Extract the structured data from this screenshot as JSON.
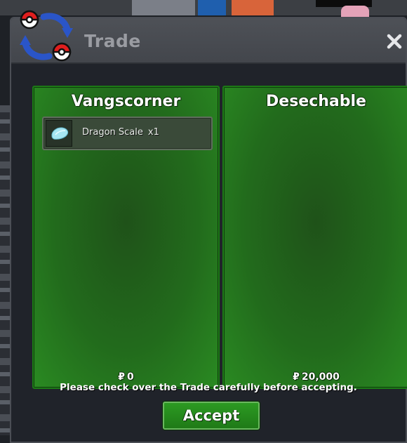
{
  "window": {
    "title": "Trade",
    "close_icon": "close-icon",
    "logo_icon": "trade-exchange-icon"
  },
  "left_panel": {
    "player_name": "Vangscorner",
    "currency_symbol": "₽",
    "money": "0",
    "items": [
      {
        "name": "Dragon Scale",
        "quantity": "x1",
        "icon": "dragon-scale-icon"
      }
    ]
  },
  "right_panel": {
    "player_name": "Desechable",
    "currency_symbol": "₽",
    "money": "20,000",
    "items": []
  },
  "footer": {
    "notice": "Please check over the Trade carefully before accepting.",
    "accept_label": "Accept"
  },
  "colors": {
    "panel_green": "#226b1c",
    "panel_border": "#1c7a16",
    "accept_green": "#2c9a22",
    "title_bar": "#4e5157",
    "window_bg": "#20232a"
  }
}
